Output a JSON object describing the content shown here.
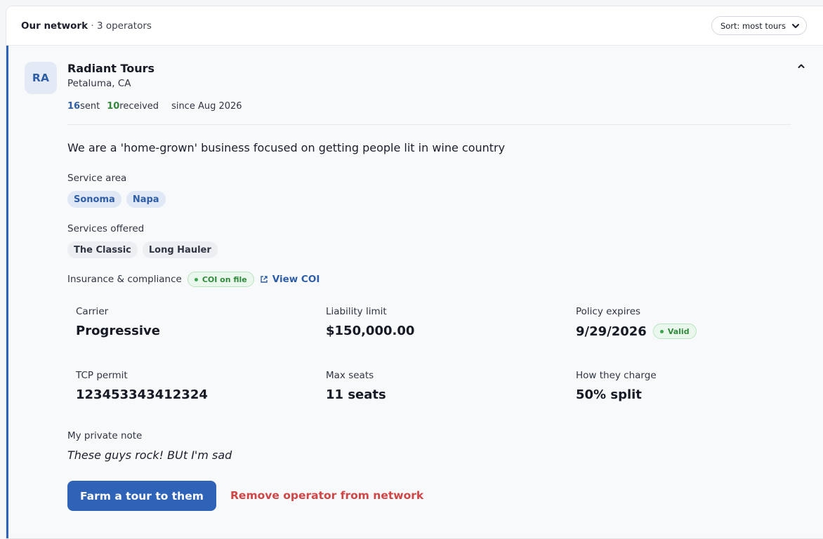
{
  "header": {
    "title": "Our network",
    "separator": " · ",
    "count": "3 operators",
    "sort_label": "Sort: most tours"
  },
  "operator": {
    "initials": "RA",
    "name": "Radiant Tours",
    "location": "Petaluma, CA",
    "sent_count": "16",
    "sent_label": " sent",
    "received_count": "10",
    "received_label": " received",
    "since": "since Aug 2026",
    "tagline": "We are a 'home-grown' business focused on getting people lit in wine country",
    "service_area_label": "Service area",
    "service_areas": [
      "Sonoma",
      "Napa"
    ],
    "services_label": "Services offered",
    "services": [
      "The Classic",
      "Long Hauler"
    ],
    "insurance_label": "Insurance & compliance",
    "coi_badge": "COI on file",
    "view_coi": "View COI",
    "details": {
      "carrier_label": "Carrier",
      "carrier": "Progressive",
      "liability_label": "Liability limit",
      "liability": "$150,000.00",
      "expires_label": "Policy expires",
      "expires": "9/29/2026",
      "expires_status": "Valid",
      "tcp_label": "TCP permit",
      "tcp": "123453343412324",
      "seats_label": "Max seats",
      "seats": "11 seats",
      "charge_label": "How they charge",
      "charge": "50% split"
    },
    "note_label": "My private note",
    "note": "These guys rock! BUt I'm sad",
    "farm_button": "Farm a tour to them",
    "remove_button": "Remove operator from network"
  },
  "colors": {
    "accent": "#2e63b8",
    "success": "#2f8a3b",
    "danger": "#d04545"
  }
}
